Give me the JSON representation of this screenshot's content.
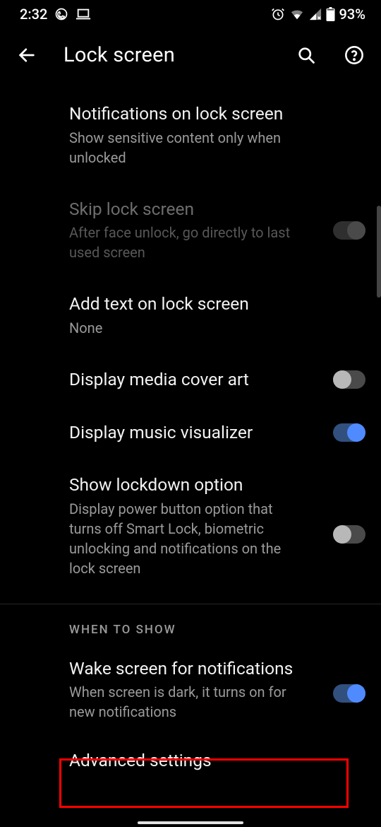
{
  "statusBar": {
    "time": "2:32",
    "battery": "93%"
  },
  "header": {
    "title": "Lock screen"
  },
  "items": {
    "notifications": {
      "title": "Notifications on lock screen",
      "subtitle": "Show sensitive content only when unlocked"
    },
    "skip": {
      "title": "Skip lock screen",
      "subtitle": "After face unlock, go directly to last used screen"
    },
    "addText": {
      "title": "Add text on lock screen",
      "subtitle": "None"
    },
    "coverArt": {
      "title": "Display media cover art"
    },
    "visualizer": {
      "title": "Display music visualizer"
    },
    "lockdown": {
      "title": "Show lockdown option",
      "subtitle": "Display power button option that turns off Smart Lock, biometric unlocking and notifications on the lock screen"
    },
    "wake": {
      "title": "Wake screen for notifications",
      "subtitle": "When screen is dark, it turns on for new notifications"
    },
    "advanced": {
      "title": "Advanced settings"
    }
  },
  "section": {
    "whenToShow": "WHEN TO SHOW"
  }
}
